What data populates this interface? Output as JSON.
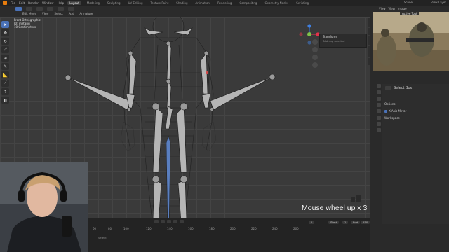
{
  "topbar": {
    "menu": [
      "File",
      "Edit",
      "Render",
      "Window",
      "Help"
    ],
    "workspace_tabs": [
      "Layout",
      "Modeling",
      "Sculpting",
      "UV Editing",
      "Texture Paint",
      "Shading",
      "Animation",
      "Rendering",
      "Compositing",
      "Geometry Nodes",
      "Scripting"
    ],
    "active_tab": "Layout",
    "scene_label": "Scene",
    "view_layer_label": "View Layer"
  },
  "viewport_header": {
    "mode_menu": [
      "View",
      "Select",
      "Add",
      "Armature"
    ]
  },
  "viewport": {
    "mode_label": "Edit Mode",
    "overlay_lines": [
      "Front Orthographic",
      "(0) metarig",
      "10 Centimeters"
    ]
  },
  "npanel": {
    "title": "Transform",
    "subtitle": "Nothing selected"
  },
  "sidebar_tabs": [
    "Item",
    "Tool",
    "View",
    "Create",
    "Edit"
  ],
  "image_editor": {
    "menu": [
      "View",
      "View",
      "Image"
    ],
    "active_tool_tab": "Active Tool"
  },
  "properties": {
    "select_box_label": "Select Box",
    "options_label": "Options",
    "xaxis_mirror_label": "X-Axis Mirror",
    "workspace_label": "Workspace"
  },
  "timeline": {
    "ticks": [
      "40",
      "60",
      "80",
      "100",
      "120",
      "140",
      "160",
      "180",
      "200",
      "220",
      "240",
      "260"
    ],
    "current_frame": "1",
    "start_label": "Start",
    "start_value": "1",
    "end_label": "End",
    "end_value": "250"
  },
  "status": {
    "left": "Select",
    "version": "2.93.4"
  },
  "caption": "Mouse wheel up x 3",
  "icons": {
    "tools": [
      "cursor-icon",
      "move-icon",
      "rotate-icon",
      "scale-icon",
      "transform-icon",
      "annotate-icon",
      "measure-icon",
      "bone-icon",
      "extrude-icon",
      "roll-icon"
    ]
  },
  "colors": {
    "accent": "#4a72b8",
    "bone_fill": "#b9b9b9",
    "viewport_bg": "#3a3a3a",
    "gizmo_x": "#e2324a",
    "gizmo_y": "#7ec24a",
    "gizmo_z": "#3f7fe0"
  }
}
